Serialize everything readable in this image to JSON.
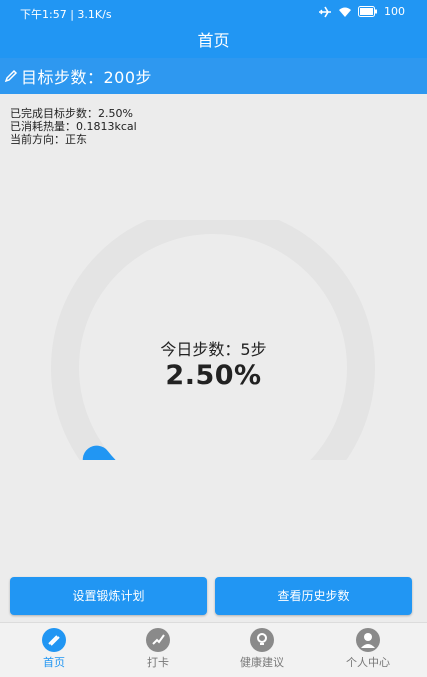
{
  "status": {
    "time_speed": "下午1:57 | 3.1K/s",
    "battery": "100"
  },
  "appbar": {
    "title": "首页"
  },
  "goal": {
    "text": "目标步数：200步"
  },
  "info": {
    "completed": "已完成目标步数：2.50%",
    "calories": "已消耗热量：0.1813kcal",
    "direction": "当前方向：正东"
  },
  "gauge": {
    "today_steps": "今日步数：5步",
    "percent_text": "2.50%",
    "progress": 0.025,
    "track_color": "#e4e4e4",
    "progress_color": "#2196f3"
  },
  "buttons": {
    "set_plan": "设置锻炼计划",
    "history": "查看历史步数"
  },
  "tabs": [
    {
      "label": "首页",
      "icon": "home-icon",
      "active": true
    },
    {
      "label": "打卡",
      "icon": "checkin-icon",
      "active": false
    },
    {
      "label": "健康建议",
      "icon": "health-icon",
      "active": false
    },
    {
      "label": "个人中心",
      "icon": "profile-icon",
      "active": false
    }
  ],
  "colors": {
    "primary": "#2196f3",
    "background": "#ececec"
  }
}
